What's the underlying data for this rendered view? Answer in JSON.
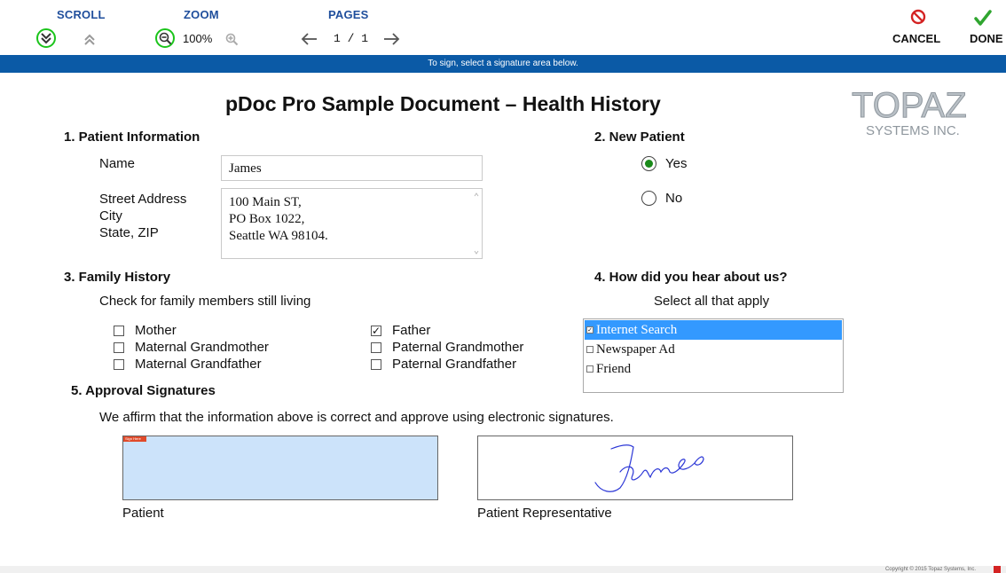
{
  "toolbar": {
    "scroll_label": "SCROLL",
    "zoom_label": "ZOOM",
    "pages_label": "PAGES",
    "zoom_value": "100%",
    "page_value": "1 / 1",
    "cancel_label": "CANCEL",
    "done_label": "DONE",
    "colors": {
      "label_blue": "#1f4e9c",
      "highlight_green": "#1bc41b",
      "cancel_red": "#d42323",
      "done_green": "#2fa52f"
    }
  },
  "infobar": {
    "text": "To sign, select a signature area below.",
    "color": "#0b5aa6"
  },
  "document": {
    "title": "pDoc Pro Sample Document – Health History",
    "logo": {
      "line1": "TOPAZ",
      "line2": "SYSTEMS INC."
    },
    "section1": {
      "heading": "1.  Patient Information",
      "name_label": "Name",
      "name_value": "James",
      "address_labels": [
        "Street Address",
        "City",
        "State, ZIP"
      ],
      "address_lines": [
        "100 Main ST,",
        "PO Box 1022,",
        "Seattle WA 98104."
      ]
    },
    "section2": {
      "heading": "2.  New Patient",
      "options": [
        {
          "label": "Yes",
          "selected": true
        },
        {
          "label": "No",
          "selected": false
        }
      ]
    },
    "section3": {
      "heading": "3.  Family History",
      "instruction": "Check for family members still living",
      "members": [
        {
          "label": "Mother",
          "checked": false
        },
        {
          "label": "Maternal Grandmother",
          "checked": false
        },
        {
          "label": "Maternal Grandfather",
          "checked": false
        },
        {
          "label": "Father",
          "checked": true
        },
        {
          "label": "Paternal Grandmother",
          "checked": false
        },
        {
          "label": "Paternal Grandfather",
          "checked": false
        }
      ]
    },
    "section4": {
      "heading": "4.  How did you hear about us?",
      "instruction": "Select all that apply",
      "options": [
        {
          "label": "Internet Search",
          "selected": true
        },
        {
          "label": "Newspaper Ad",
          "selected": false
        },
        {
          "label": "Friend",
          "selected": false
        }
      ]
    },
    "section5": {
      "heading": "5.  Approval Signatures",
      "statement": "We affirm that the information above is correct and approve using electronic signatures.",
      "sig_patient_label": "Patient",
      "sig_patient_tag": "Sign Here",
      "sig_rep_label": "Patient Representative",
      "sig_rep_signature": "James"
    }
  },
  "footer": {
    "copyright": "Copyright © 2015 Topaz Systems, Inc."
  }
}
